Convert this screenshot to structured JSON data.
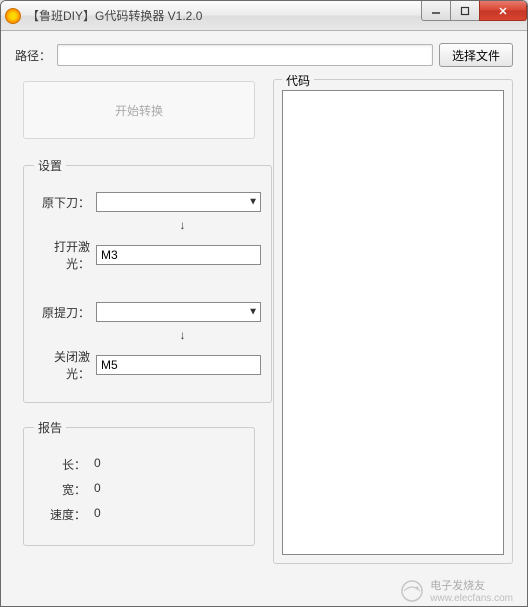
{
  "window": {
    "title": "【鲁班DIY】G代码转换器 V1.2.0"
  },
  "path": {
    "label": "路径：",
    "value": "",
    "browse_button": "选择文件"
  },
  "start_button": "开始转换",
  "settings": {
    "legend": "设置",
    "orig_down_label": "原下刀：",
    "orig_down_value": "",
    "laser_on_label": "打开激光：",
    "laser_on_value": "M3",
    "orig_up_label": "原提刀：",
    "orig_up_value": "",
    "laser_off_label": "关闭激光：",
    "laser_off_value": "M5"
  },
  "report": {
    "legend": "报告",
    "length_label": "长：",
    "length_value": "0",
    "width_label": "宽：",
    "width_value": "0",
    "speed_label": "速度：",
    "speed_value": "0"
  },
  "code": {
    "legend": "代码",
    "value": ""
  },
  "watermark": {
    "text": "电子发烧友",
    "url": "www.elecfans.com"
  }
}
